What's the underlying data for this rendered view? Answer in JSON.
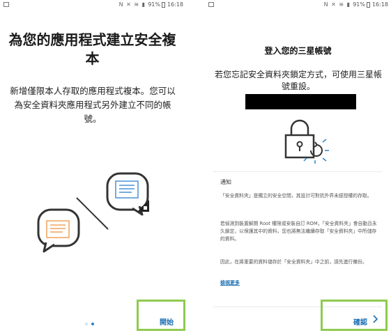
{
  "status_bar": {
    "icons": "N ✕ ≋ ▮",
    "battery": "91%",
    "time": "16:18"
  },
  "screen1": {
    "title": "為您的應用程式建立安全複本",
    "description": "新增僅限本人存取的應用程式複本。您可以為安全資料夾應用程式另外建立不同的帳號。",
    "start_button": "開始"
  },
  "screen2": {
    "title": "登入您的三星帳號",
    "description": "若您忘記安全資料夾鎖定方式，可使用三星帳號重設。",
    "notice_title": "通知",
    "paragraphs": [
      "「安全資料夾」是獨立的安全空間，其設計可對抗外界未經授權的存取。",
      "若偵測到裝置解開 Root 權限或安裝自訂 ROM，「安全資料夾」會自動且永久鎖定，以保護其中的資料，您也將無法繼續存取「安全資料夾」中所儲存的資料。",
      "因此，在將重要的資料儲存於「安全資料夾」中之前，請先進行備份。"
    ],
    "more_link": "檢視更多",
    "confirm_button": "確認",
    "confirm_icon": "chevron-right-icon"
  },
  "colors": {
    "accent": "#1d6fb3",
    "highlight": "#8ecb4f",
    "dot_active": "#2a86c8",
    "dot_inactive": "#cfe4f0"
  }
}
